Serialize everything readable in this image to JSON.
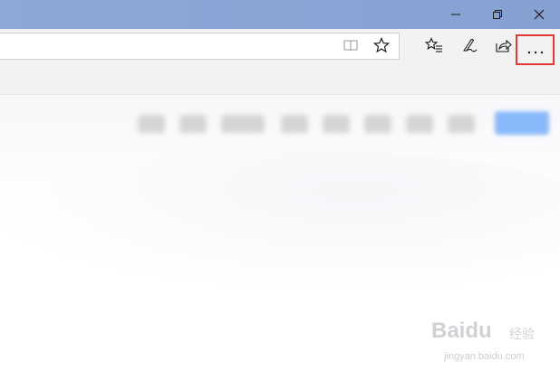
{
  "window_controls": {
    "minimize_icon": "minimize-icon",
    "restore_icon": "restore-icon",
    "close_icon": "close-icon"
  },
  "address_bar": {
    "value": "",
    "reading_view_icon": "book-icon",
    "favorite_icon": "star-icon"
  },
  "toolbar": {
    "icons": [
      "favorites-list-icon",
      "pen-icon",
      "share-icon",
      "more-icon"
    ],
    "more_label": "···"
  },
  "colors": {
    "titlebar": "#8ea7d6",
    "highlight": "#e53935",
    "page_button": "#76aefc"
  },
  "watermark": {
    "brand": "Baidu",
    "brand_cn": "经验",
    "url": "jingyan.baidu.com"
  }
}
